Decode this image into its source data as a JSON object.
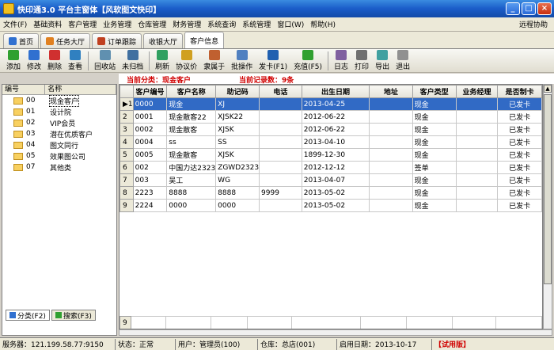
{
  "window": {
    "title": "快印通3.0  平台主窗体【风软图文快印】"
  },
  "menu": {
    "items": [
      "文件(F)",
      "基础资料",
      "客户管理",
      "业务管理",
      "仓库管理",
      "财务管理",
      "系统查询",
      "系统管理",
      "窗口(W)",
      "帮助(H)"
    ],
    "right": "远程协助"
  },
  "tabs": [
    {
      "label": "首页",
      "color": "#3070d0"
    },
    {
      "label": "任务大厅",
      "color": "#e08020"
    },
    {
      "label": "订单跟踪",
      "color": "#c04020"
    },
    {
      "label": "收银大厅",
      "color": ""
    },
    {
      "label": "客户信息",
      "color": ""
    }
  ],
  "toolbar": [
    {
      "label": "添加",
      "color": "#30a030"
    },
    {
      "label": "修改",
      "color": "#3070d0"
    },
    {
      "label": "删除",
      "color": "#d03030"
    },
    {
      "label": "查看",
      "color": "#3080c0"
    },
    {
      "label": "回收站",
      "color": "#6090b0"
    },
    {
      "label": "未归档",
      "color": "#4070a0"
    },
    {
      "label": "刷新",
      "color": "#30a060"
    },
    {
      "label": "协议价",
      "color": "#d0a020"
    },
    {
      "label": "隶属于",
      "color": "#c06030"
    },
    {
      "label": "批操作",
      "color": "#5080c0"
    },
    {
      "label": "发卡(F1)",
      "color": "#2060b0"
    },
    {
      "label": "充值(F5)",
      "color": "#30a030"
    },
    {
      "label": "日志",
      "color": "#8060a0"
    },
    {
      "label": "打印",
      "color": "#707070"
    },
    {
      "label": "导出",
      "color": "#40a0a0"
    },
    {
      "label": "退出",
      "color": "#909090"
    }
  ],
  "info": {
    "category": "当前分类：现金客户",
    "count": "当前记录数：9条"
  },
  "left": {
    "headers": [
      "编号",
      "名称"
    ],
    "items": [
      {
        "code": "00",
        "name": "现金客户"
      },
      {
        "code": "01",
        "name": "设计院"
      },
      {
        "code": "02",
        "name": "VIP会员"
      },
      {
        "code": "03",
        "name": "潜在优质客户"
      },
      {
        "code": "04",
        "name": "图文同行"
      },
      {
        "code": "05",
        "name": "效果图公司"
      },
      {
        "code": "07",
        "name": "其他类"
      }
    ],
    "tabs": [
      "分类(F2)",
      "搜索(F3)"
    ]
  },
  "grid": {
    "headers": [
      "客户编号",
      "客户名称",
      "助记码",
      "电话",
      "出生日期",
      "地址",
      "客户类型",
      "业务经理",
      "是否制卡"
    ],
    "rows": [
      [
        "0000",
        "现金",
        "XJ",
        "",
        "2013-04-25",
        "",
        "现金",
        "",
        "已发卡"
      ],
      [
        "0001",
        "现金散客22",
        "XJSK22",
        "",
        "2012-06-22",
        "",
        "现金",
        "",
        "已发卡"
      ],
      [
        "0002",
        "现金散客",
        "XJSK",
        "",
        "2012-06-22",
        "",
        "现金",
        "",
        "已发卡"
      ],
      [
        "0004",
        "ss",
        "SS",
        "",
        "2013-04-10",
        "",
        "现金",
        "",
        "已发卡"
      ],
      [
        "0005",
        "现金散客",
        "XJSK",
        "",
        "1899-12-30",
        "",
        "现金",
        "",
        "已发卡"
      ],
      [
        "002",
        "中国力达2323",
        "ZGWD2323",
        "",
        "2012-12-12",
        "",
        "签单",
        "",
        "已发卡"
      ],
      [
        "003",
        "吴工",
        "WG",
        "",
        "2013-04-07",
        "",
        "现金",
        "",
        "已发卡"
      ],
      [
        "2223",
        "8888",
        "8888",
        "9999",
        "2013-05-02",
        "",
        "现金",
        "",
        "已发卡"
      ],
      [
        "2224",
        "0000",
        "0000",
        "",
        "2013-05-02",
        "",
        "现金",
        "",
        "已发卡"
      ]
    ],
    "footer_row": "9"
  },
  "status": [
    "服务器：121.199.58.77:9150",
    "状态：正常",
    "用户：管理员(100)",
    "仓库：总店(001)",
    "启用日期：2013-10-17",
    "【试用版】"
  ]
}
